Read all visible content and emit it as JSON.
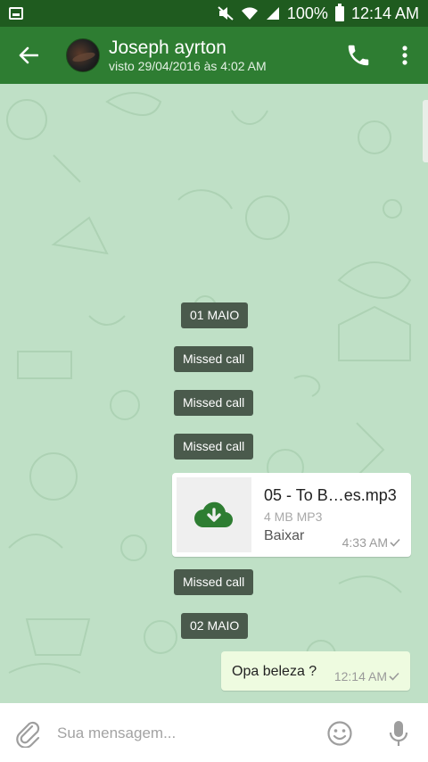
{
  "status_bar": {
    "battery": "100%",
    "time": "12:14 AM"
  },
  "header": {
    "contact_name": "Joseph ayrton",
    "last_seen": "visto 29/04/2016 às 4:02 AM"
  },
  "chat": {
    "date_separators": [
      "01 MAIO",
      "02 MAIO"
    ],
    "missed_call_label": "Missed call",
    "file_message": {
      "file_name": "05 - To B…es.mp3",
      "file_meta": "4 MB MP3",
      "action_label": "Baixar",
      "time": "4:33 AM"
    },
    "text_message": {
      "text": "Opa beleza ?",
      "time": "12:14 AM"
    }
  },
  "composer": {
    "placeholder": "Sua mensagem..."
  },
  "colors": {
    "status_bar": "#1f5b1f",
    "app_bar": "#2e7d32",
    "chat_background": "#bfe0c6",
    "service_pill": "#4a5a4c",
    "outgoing_bubble": "#eefbe0"
  }
}
